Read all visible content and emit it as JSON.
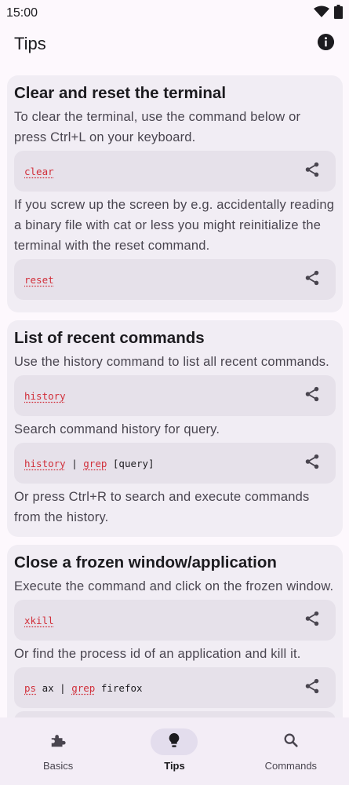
{
  "status_bar": {
    "time": "15:00"
  },
  "app_bar": {
    "title": "Tips"
  },
  "cards": [
    {
      "title": "Clear and reset the terminal",
      "text1": "To clear the terminal, use the command below or press Ctrl+L on your keyboard.",
      "cmd1": "clear",
      "text2": "If you screw up the screen by e.g. accidentally reading a binary file with cat or less you might reinitialize the terminal with the reset command.",
      "cmd2": "reset"
    },
    {
      "title": "List of recent commands",
      "text1": "Use the history command to list all recent commands.",
      "cmd1": "history",
      "text2": "Search command history for query.",
      "cmd2_parts": [
        "history",
        " | ",
        "grep",
        " [query]"
      ],
      "text3": "Or press Ctrl+R to search and execute commands from the history."
    },
    {
      "title": "Close a frozen window/application",
      "text1": "Execute the command and click on the frozen window.",
      "cmd1": "xkill",
      "text2": "Or find the process id of an application and kill it.",
      "cmd2_parts": [
        "ps",
        " ax | ",
        "grep",
        " firefox"
      ]
    }
  ],
  "bottom_nav": {
    "items": [
      {
        "label": "Basics",
        "icon": "puzzle-icon"
      },
      {
        "label": "Tips",
        "icon": "lightbulb-icon",
        "active": true
      },
      {
        "label": "Commands",
        "icon": "search-icon"
      }
    ]
  },
  "colors": {
    "background": "#fdf8fd",
    "card": "#f1edf4",
    "command_box": "#e6e1ea",
    "command_keyword": "#d12f3a",
    "nav_background": "#f3edf6",
    "nav_active_pill": "#e3dded"
  }
}
